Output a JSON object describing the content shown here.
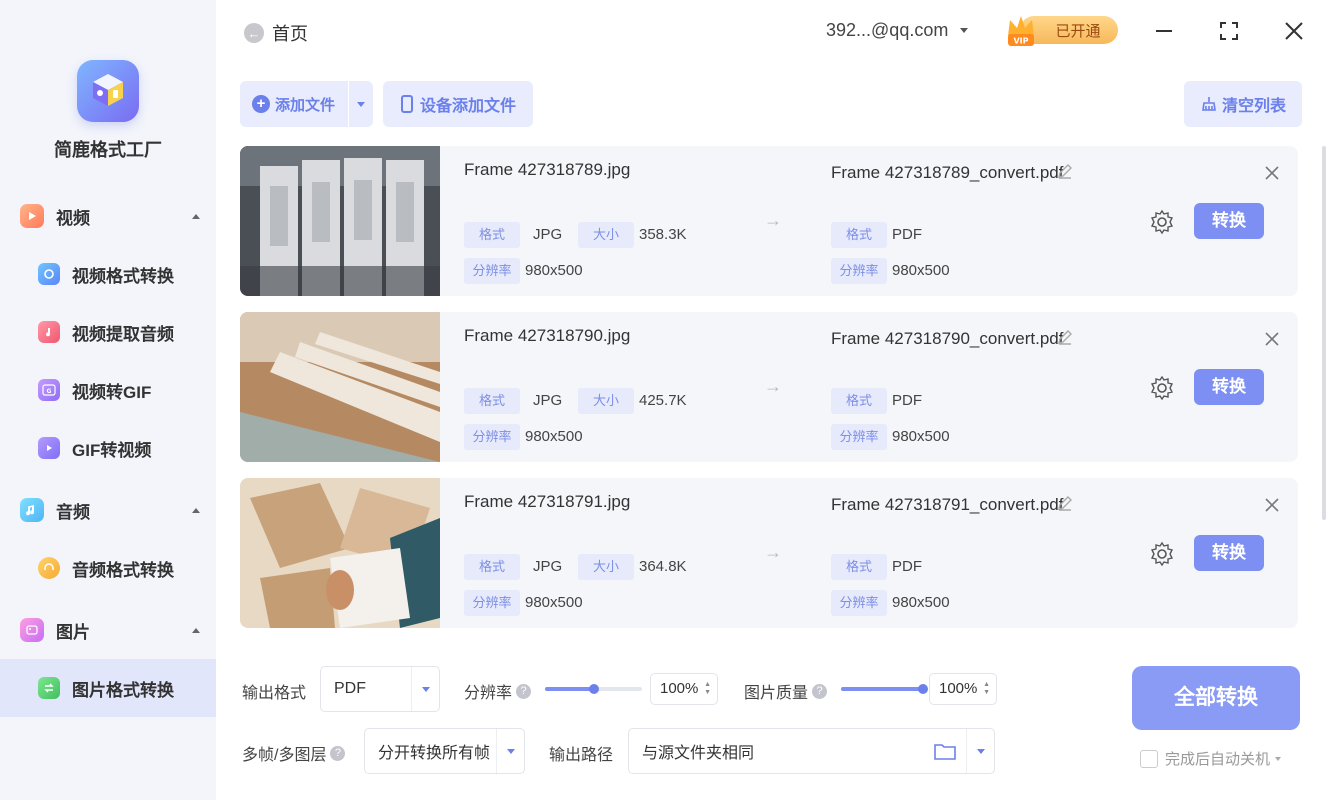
{
  "app": {
    "name": "简鹿格式工厂"
  },
  "sidebar": {
    "sections": [
      {
        "label": "视频",
        "icon": "video-icon"
      },
      {
        "label": "音频",
        "icon": "music-note-icon"
      },
      {
        "label": "图片",
        "icon": "image-icon"
      }
    ],
    "items": [
      {
        "label": "视频格式转换",
        "icon": "video-convert-icon"
      },
      {
        "label": "视频提取音频",
        "icon": "extract-audio-icon"
      },
      {
        "label": "视频转GIF",
        "icon": "gif-icon"
      },
      {
        "label": "GIF转视频",
        "icon": "gif-to-video-icon"
      },
      {
        "label": "音频格式转换",
        "icon": "headphones-icon"
      },
      {
        "label": "图片格式转换",
        "icon": "image-convert-icon",
        "active": true
      }
    ]
  },
  "header": {
    "back_label": "首页",
    "account": "392...@qq.com",
    "vip_label": "已开通",
    "vip_badge": "VIP"
  },
  "toolbar": {
    "add_file": "添加文件",
    "device_add": "设备添加文件",
    "clear_list": "清空列表"
  },
  "labels": {
    "format": "格式",
    "size": "大小",
    "resolution": "分辨率",
    "convert": "转换"
  },
  "files": [
    {
      "name": "Frame 427318789.jpg",
      "format": "JPG",
      "size": "358.3K",
      "resolution": "980x500",
      "output_name": "Frame 427318789_convert.pdf",
      "output_format": "PDF",
      "output_resolution": "980x500"
    },
    {
      "name": "Frame 427318790.jpg",
      "format": "JPG",
      "size": "425.7K",
      "resolution": "980x500",
      "output_name": "Frame 427318790_convert.pdf",
      "output_format": "PDF",
      "output_resolution": "980x500"
    },
    {
      "name": "Frame 427318791.jpg",
      "format": "JPG",
      "size": "364.8K",
      "resolution": "980x500",
      "output_name": "Frame 427318791_convert.pdf",
      "output_format": "PDF",
      "output_resolution": "980x500"
    }
  ],
  "settings": {
    "output_format_label": "输出格式",
    "output_format_value": "PDF",
    "resolution_label": "分辨率",
    "resolution_value": "100%",
    "resolution_level": 0.5,
    "quality_label": "图片质量",
    "quality_value": "100%",
    "quality_level": 1.0,
    "multiframe_label": "多帧/多图层",
    "multiframe_value": "分开转换所有帧",
    "output_path_label": "输出路径",
    "output_path_value": "与源文件夹相同",
    "convert_all": "全部转换",
    "auto_shutdown": "完成后自动关机"
  },
  "colors": {
    "accent": "#7d8ff2",
    "sidebar_bg": "#f3f5fb",
    "active_item_bg": "#e2e6fb",
    "tag_bg": "#e6eafb",
    "vip_gold": "#f7b85a"
  }
}
